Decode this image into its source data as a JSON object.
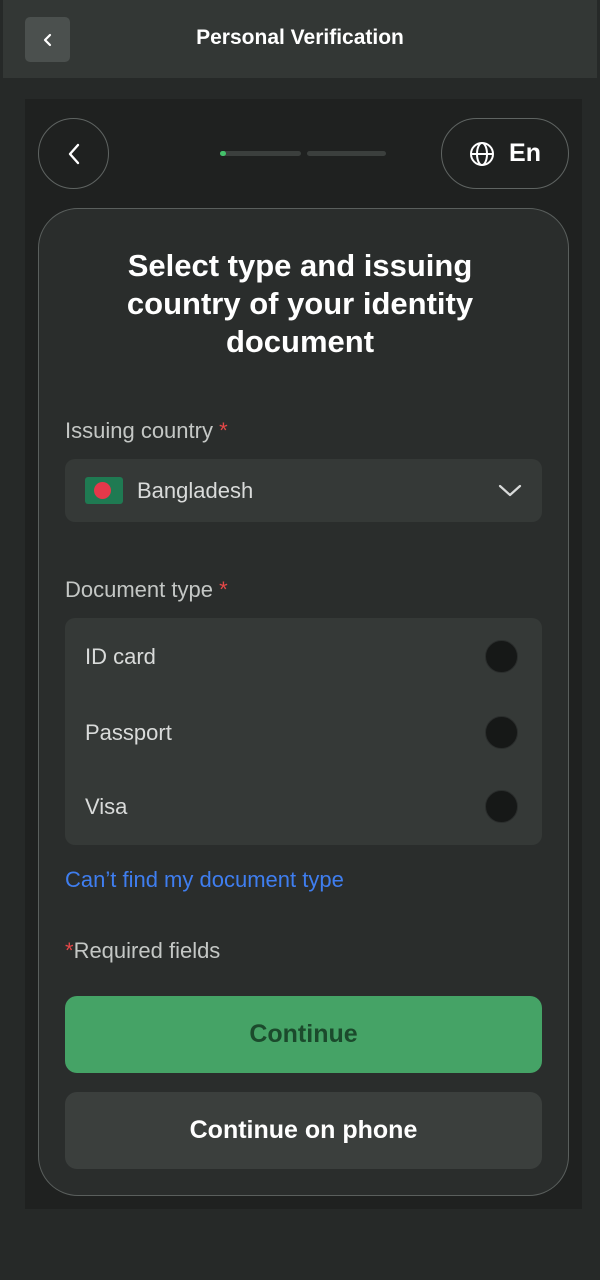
{
  "header": {
    "title": "Personal Verification",
    "back_icon": "chevron-left-icon"
  },
  "nav": {
    "back_icon": "chevron-left-icon",
    "progress": {
      "steps": 2,
      "current_step": 1,
      "fill": 0.08,
      "accent": "#44c06a"
    },
    "language": {
      "icon": "globe-icon",
      "label": "En"
    }
  },
  "form": {
    "heading": "Select type and issuing country of your identity document",
    "country": {
      "label": "Issuing country",
      "required_mark": "*",
      "value": "Bangladesh",
      "flag_icon": "bangladesh-flag-icon",
      "dropdown_icon": "chevron-down-icon"
    },
    "document": {
      "label": "Document type",
      "required_mark": "*",
      "options": [
        {
          "label": "ID card",
          "selected": false
        },
        {
          "label": "Passport",
          "selected": false
        },
        {
          "label": "Visa",
          "selected": false
        }
      ]
    },
    "cant_find_link": "Can’t find my document type",
    "required_note": {
      "mark": "*",
      "text": "Required fields"
    },
    "continue_label": "Continue",
    "continue_phone_label": "Continue on phone"
  },
  "colors": {
    "background": "#262928",
    "card": "#2a2d2c",
    "primary_button": "#45a366",
    "link": "#3f7ef0",
    "required": "#e54848"
  }
}
